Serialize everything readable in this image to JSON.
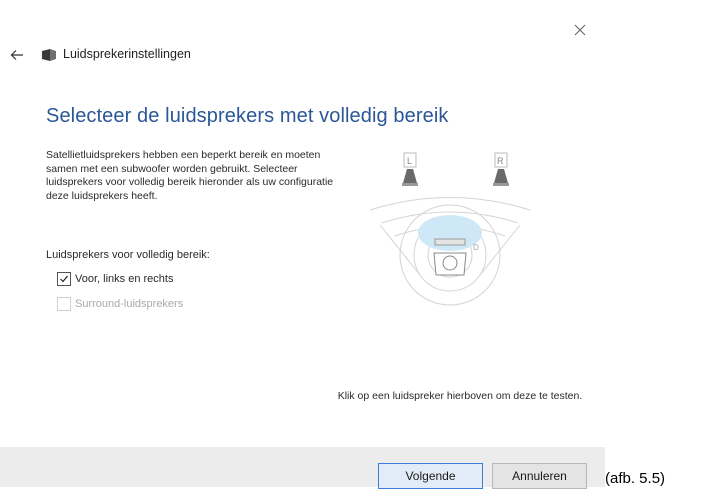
{
  "window": {
    "title": "Luidsprekerinstellingen"
  },
  "page": {
    "heading": "Selecteer de luidsprekers met volledig bereik",
    "description": "Satellietluidsprekers hebben een beperkt bereik en moeten samen met een subwoofer worden gebruikt. Selecteer luidsprekers voor volledig bereik hieronder als uw configuratie deze luidsprekers heeft.",
    "group_label": "Luidsprekers voor volledig bereik:",
    "options": [
      {
        "label": "Voor, links en rechts",
        "checked": true,
        "enabled": true
      },
      {
        "label": "Surround-luidsprekers",
        "checked": false,
        "enabled": false
      }
    ],
    "speakers": {
      "left": "L",
      "right": "R"
    },
    "hint": "Klik op een luidspreker hierboven om deze te testen."
  },
  "footer": {
    "next_label": "Volgende",
    "cancel_label": "Annuleren"
  },
  "caption": "(afb. 5.5)",
  "colors": {
    "heading": "#2b5797",
    "accent": "#3c7fd8",
    "footer_bg": "#ececec"
  }
}
